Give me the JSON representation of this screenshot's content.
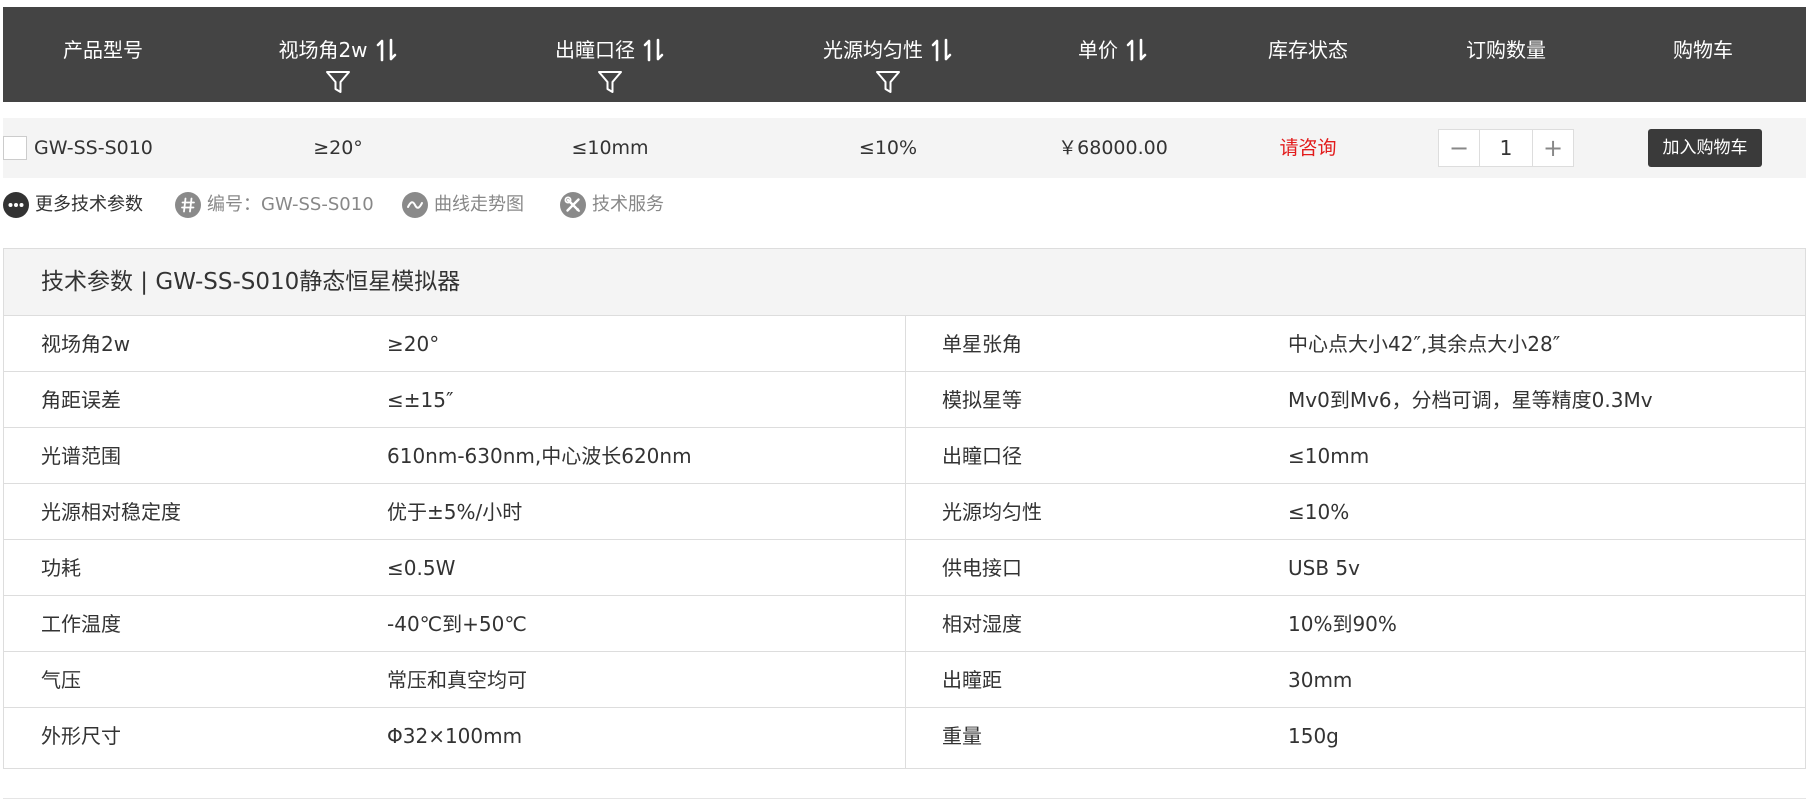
{
  "header": {
    "columns": [
      {
        "label": "产品型号"
      },
      {
        "label": "视场角2w"
      },
      {
        "label": "出瞳口径"
      },
      {
        "label": "光源均匀性"
      },
      {
        "label": "单价"
      },
      {
        "label": "库存状态"
      },
      {
        "label": "订购数量"
      },
      {
        "label": "购物车"
      }
    ]
  },
  "product": {
    "model": "GW-SS-S010",
    "fov": "≥20°",
    "pupil": "≤10mm",
    "uniformity": "≤10%",
    "price": "￥68000.00",
    "stock": "请咨询",
    "quantity": "1",
    "minus": "−",
    "plus": "+",
    "cart_button": "加入购物车"
  },
  "links": {
    "more": "更多技术参数",
    "code": "编号：GW-SS-S010",
    "curve": "曲线走势图",
    "service": "技术服务"
  },
  "specs": {
    "title": "技术参数 | GW-SS-S010静态恒星模拟器",
    "rows": [
      {
        "k1": "视场角2w",
        "v1": "≥20°",
        "k2": "单星张角",
        "v2": "中心点大小42″,其余点大小28″"
      },
      {
        "k1": "角距误差",
        "v1": "≤±15″",
        "k2": "模拟星等",
        "v2": "Mv0到Mv6，分档可调，星等精度0.3Mv"
      },
      {
        "k1": "光谱范围",
        "v1": "610nm-630nm,中心波长620nm",
        "k2": "出瞳口径",
        "v2": "≤10mm"
      },
      {
        "k1": "光源相对稳定度",
        "v1": "优于±5%/小时",
        "k2": "光源均匀性",
        "v2": "≤10%"
      },
      {
        "k1": "功耗",
        "v1": "≤0.5W",
        "k2": "供电接口",
        "v2": "USB 5v"
      },
      {
        "k1": "工作温度",
        "v1": "-40℃到+50℃",
        "k2": "相对湿度",
        "v2": "10%到90%"
      },
      {
        "k1": "气压",
        "v1": "常压和真空均可",
        "k2": "出瞳距",
        "v2": "30mm"
      },
      {
        "k1": "外形尺寸",
        "v1": "Φ32×100mm",
        "k2": "重量",
        "v2": "150g"
      }
    ]
  },
  "colors": {
    "header_bg": "#444444",
    "stock_red": "#e21b1b",
    "button_bg": "#3a3a3a"
  }
}
